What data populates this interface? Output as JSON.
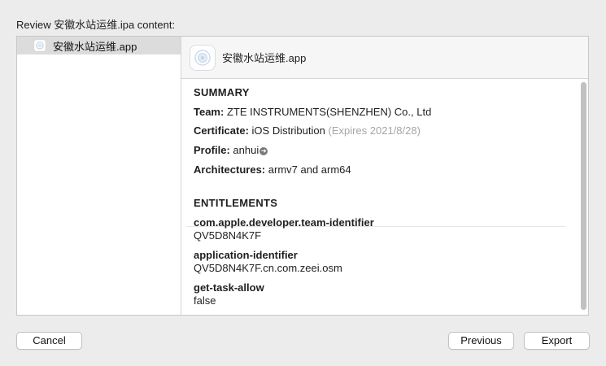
{
  "dialog": {
    "heading": "Review 安徽水站运维.ipa content:"
  },
  "sidebar": {
    "items": [
      {
        "label": "安徽水站运维.app",
        "icon": "app-icon"
      }
    ]
  },
  "detail": {
    "title": "安徽水站运维.app",
    "icon": "app-icon",
    "summary": {
      "heading": "SUMMARY",
      "team_label": "Team:",
      "team_value": "ZTE INSTRUMENTS(SHENZHEN) Co., Ltd",
      "certificate_label": "Certificate:",
      "certificate_value": "iOS Distribution",
      "certificate_expiry": "(Expires 2021/8/28)",
      "profile_label": "Profile:",
      "profile_value": "anhui",
      "architectures_label": "Architectures:",
      "architectures_value": "armv7 and arm64"
    },
    "entitlements": {
      "heading": "ENTITLEMENTS",
      "items": [
        {
          "key": "com.apple.developer.team-identifier",
          "value": "QV5D8N4K7F"
        },
        {
          "key": "application-identifier",
          "value": "QV5D8N4K7F.cn.com.zeei.osm"
        },
        {
          "key": "get-task-allow",
          "value": "false"
        }
      ]
    }
  },
  "buttons": {
    "cancel": "Cancel",
    "previous": "Previous",
    "export": "Export"
  }
}
